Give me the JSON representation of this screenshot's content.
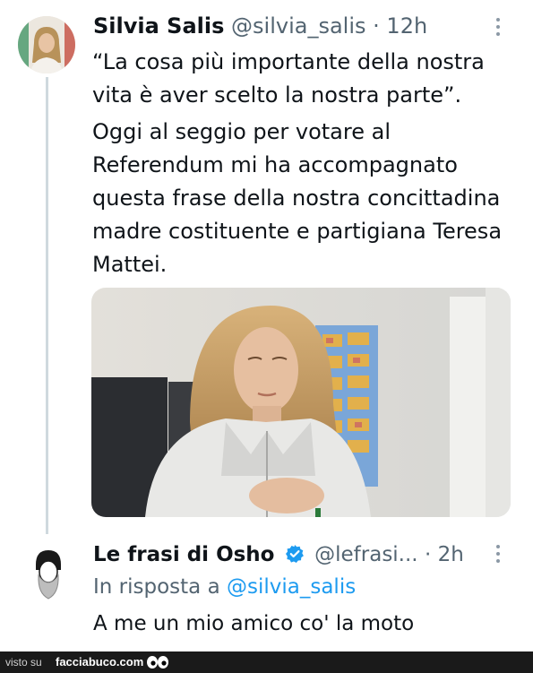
{
  "tweet": {
    "author_name": "Silvia Salis",
    "author_handle": "@silvia_salis",
    "separator": "·",
    "time": "12h",
    "text_line1": "“La cosa più importante della nostra vita è aver scelto la nostra parte”.",
    "text_line2": "Oggi al seggio per votare al Referendum mi ha accompagnato questa frase della nostra concittadina madre costituente e partigiana Teresa Mattei.",
    "more_icon": "more-vertical-icon"
  },
  "reply": {
    "author_name": "Le frasi di Osho",
    "verified_icon": "verified-badge-icon",
    "author_handle": "@lefrasi...",
    "separator": "·",
    "time": "2h",
    "context_prefix": "In risposta a",
    "context_mention": "@silvia_salis",
    "text": "A me un mio amico co' la moto",
    "more_icon": "more-vertical-icon"
  },
  "footer": {
    "prefix": "visto su",
    "brand": "facciabuco.com"
  },
  "colors": {
    "text": "#0f1419",
    "secondary": "#536471",
    "link": "#1d9bf0",
    "thread_line": "#cfd9de"
  }
}
